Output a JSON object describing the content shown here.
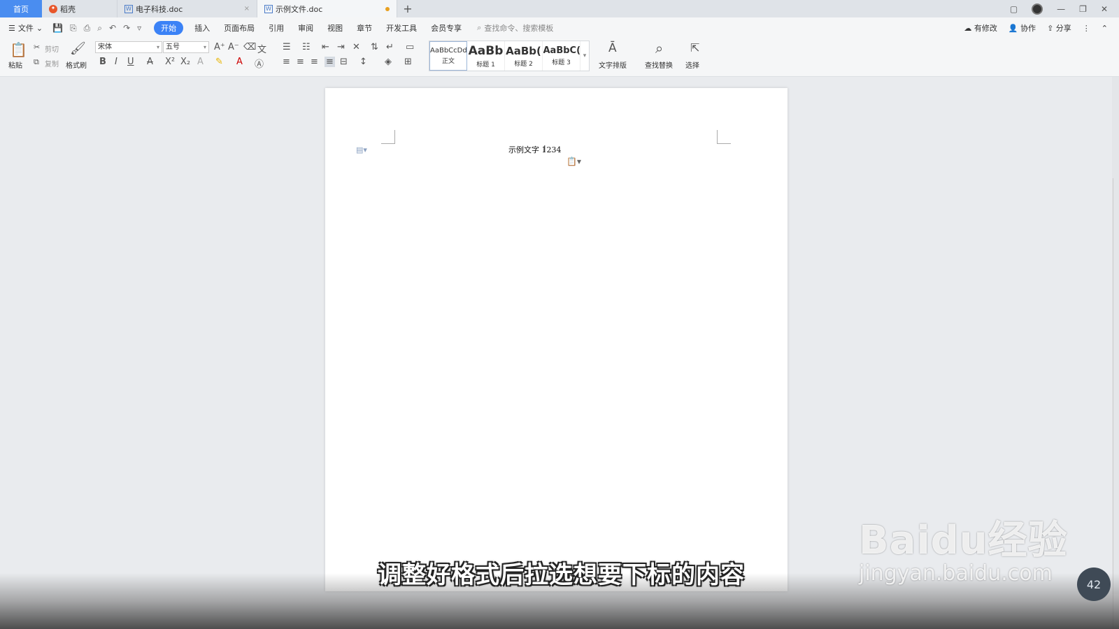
{
  "tabs": {
    "home": "首页",
    "items": [
      {
        "label": "稻壳",
        "icon": "daoke-icon"
      },
      {
        "label": "电子科技.doc",
        "icon": "word-doc-icon"
      },
      {
        "label": "示例文件.doc",
        "icon": "word-doc-icon",
        "active": true
      }
    ]
  },
  "menu": {
    "file": "文件",
    "items": [
      "开始",
      "插入",
      "页面布局",
      "引用",
      "审阅",
      "视图",
      "章节",
      "开发工具",
      "会员专享"
    ],
    "active": "开始",
    "search_placeholder": "查找命令、搜索模板",
    "right": {
      "revise": "有修改",
      "collab": "协作",
      "share": "分享"
    }
  },
  "ribbon": {
    "paste": "粘贴",
    "cut": "剪切",
    "copy": "复制",
    "format_painter": "格式刷",
    "font_name": "宋体",
    "font_size": "五号",
    "styles": [
      {
        "sample": "AaBbCcDd",
        "name": "正文"
      },
      {
        "sample": "AaBb",
        "name": "标题 1"
      },
      {
        "sample": "AaBb(",
        "name": "标题 2"
      },
      {
        "sample": "AaBbC(",
        "name": "标题 3"
      }
    ],
    "text_layout": "文字排版",
    "find_replace": "查找替换",
    "select": "选择"
  },
  "document": {
    "text": "示例文字 1234"
  },
  "overlay": {
    "subtitle": "调整好格式后拉选想要下标的内容",
    "watermark_logo": "Baidu经验",
    "watermark_url": "jingyan.baidu.com",
    "badge": "42"
  },
  "colors": {
    "accent": "#3b82f6",
    "home_tab": "#4a8df0"
  }
}
